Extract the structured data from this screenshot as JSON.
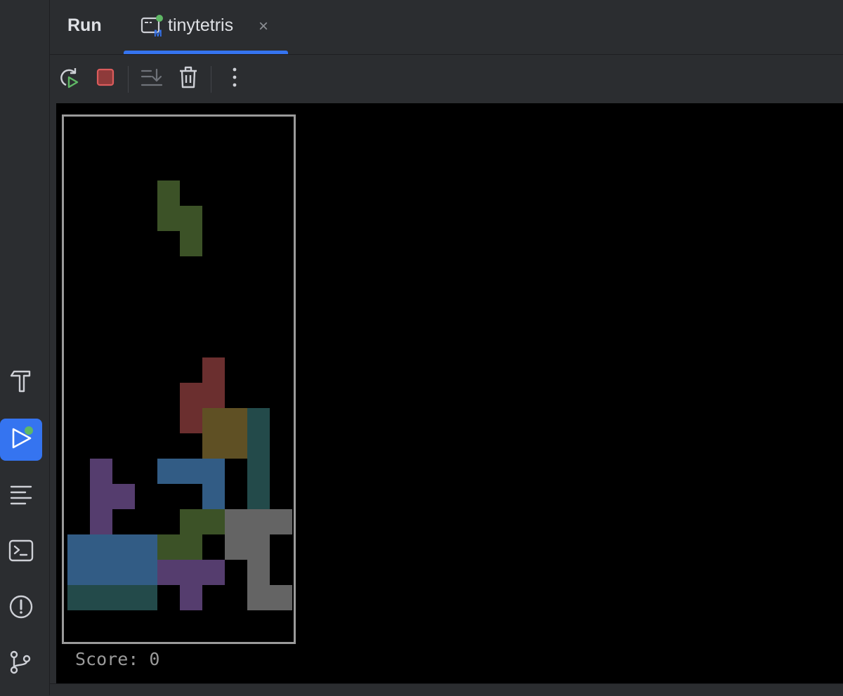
{
  "run_panel": {
    "title": "Run",
    "tab_label": "tinytetris",
    "tab_icon_badge": "M",
    "tab_close_glyph": "×"
  },
  "toolbar": {
    "buttons": [
      "rerun-icon",
      "stop-icon",
      "scroll-to-end-icon",
      "clear-all-icon",
      "more-options-icon"
    ]
  },
  "left_toolbar": {
    "items": [
      "build-icon",
      "run-icon",
      "structure-icon",
      "terminal-icon",
      "problems-icon",
      "git-icon"
    ],
    "active": "run-icon"
  },
  "colors": {
    "accent": "#3574f0",
    "running_dot": "#5fb865",
    "stop_red": "#db5c5c",
    "green": "#3c5227",
    "red": "#6b2f2f",
    "yellow": "#5f5024",
    "teal": "#234a4a",
    "blue": "#325c85",
    "purple": "#553d6e",
    "gray": "#646464"
  },
  "game": {
    "columns": 10,
    "rows": 20,
    "score_text": "Score: 0",
    "falling_piece": {
      "color": "green",
      "cells": [
        [
          4,
          3
        ],
        [
          4,
          4
        ],
        [
          5,
          4
        ],
        [
          5,
          5
        ]
      ]
    },
    "locked_cells": [
      {
        "c": 6,
        "r": 10,
        "color": "red"
      },
      {
        "c": 5,
        "r": 11,
        "color": "red"
      },
      {
        "c": 6,
        "r": 11,
        "color": "red"
      },
      {
        "c": 5,
        "r": 12,
        "color": "red"
      },
      {
        "c": 6,
        "r": 12,
        "color": "yellow"
      },
      {
        "c": 7,
        "r": 12,
        "color": "yellow"
      },
      {
        "c": 6,
        "r": 13,
        "color": "yellow"
      },
      {
        "c": 7,
        "r": 13,
        "color": "yellow"
      },
      {
        "c": 8,
        "r": 12,
        "color": "teal"
      },
      {
        "c": 8,
        "r": 13,
        "color": "teal"
      },
      {
        "c": 8,
        "r": 14,
        "color": "teal"
      },
      {
        "c": 8,
        "r": 15,
        "color": "teal"
      },
      {
        "c": 1,
        "r": 14,
        "color": "purple"
      },
      {
        "c": 1,
        "r": 15,
        "color": "purple"
      },
      {
        "c": 2,
        "r": 15,
        "color": "purple"
      },
      {
        "c": 1,
        "r": 16,
        "color": "purple"
      },
      {
        "c": 4,
        "r": 14,
        "color": "blue"
      },
      {
        "c": 5,
        "r": 14,
        "color": "blue"
      },
      {
        "c": 6,
        "r": 14,
        "color": "blue"
      },
      {
        "c": 6,
        "r": 15,
        "color": "blue"
      },
      {
        "c": 5,
        "r": 16,
        "color": "green"
      },
      {
        "c": 6,
        "r": 16,
        "color": "green"
      },
      {
        "c": 4,
        "r": 17,
        "color": "green"
      },
      {
        "c": 5,
        "r": 17,
        "color": "green"
      },
      {
        "c": 7,
        "r": 16,
        "color": "gray"
      },
      {
        "c": 8,
        "r": 16,
        "color": "gray"
      },
      {
        "c": 9,
        "r": 16,
        "color": "gray"
      },
      {
        "c": 7,
        "r": 17,
        "color": "gray"
      },
      {
        "c": 8,
        "r": 17,
        "color": "gray"
      },
      {
        "c": 8,
        "r": 18,
        "color": "gray"
      },
      {
        "c": 8,
        "r": 19,
        "color": "gray"
      },
      {
        "c": 9,
        "r": 19,
        "color": "gray"
      },
      {
        "c": 0,
        "r": 17,
        "color": "blue"
      },
      {
        "c": 1,
        "r": 17,
        "color": "blue"
      },
      {
        "c": 2,
        "r": 17,
        "color": "blue"
      },
      {
        "c": 3,
        "r": 17,
        "color": "blue"
      },
      {
        "c": 0,
        "r": 18,
        "color": "blue"
      },
      {
        "c": 1,
        "r": 18,
        "color": "blue"
      },
      {
        "c": 2,
        "r": 18,
        "color": "blue"
      },
      {
        "c": 3,
        "r": 18,
        "color": "blue"
      },
      {
        "c": 0,
        "r": 19,
        "color": "teal"
      },
      {
        "c": 1,
        "r": 19,
        "color": "teal"
      },
      {
        "c": 2,
        "r": 19,
        "color": "teal"
      },
      {
        "c": 3,
        "r": 19,
        "color": "teal"
      },
      {
        "c": 4,
        "r": 18,
        "color": "purple"
      },
      {
        "c": 5,
        "r": 18,
        "color": "purple"
      },
      {
        "c": 6,
        "r": 18,
        "color": "purple"
      },
      {
        "c": 5,
        "r": 19,
        "color": "purple"
      }
    ]
  }
}
